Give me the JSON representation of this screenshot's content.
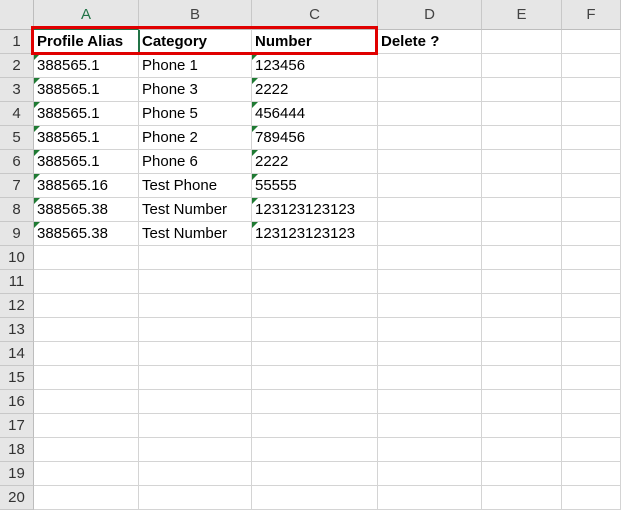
{
  "columns": [
    "A",
    "B",
    "C",
    "D",
    "E",
    "F"
  ],
  "rows": [
    {
      "n": "1",
      "a": "Profile Alias",
      "b": "Category",
      "c": "Number",
      "d": "Delete ?",
      "bold": true
    },
    {
      "n": "2",
      "a": "388565.1",
      "b": "Phone 1",
      "c": "123456"
    },
    {
      "n": "3",
      "a": "388565.1",
      "b": "Phone 3",
      "c": "2222"
    },
    {
      "n": "4",
      "a": "388565.1",
      "b": "Phone 5",
      "c": "456444"
    },
    {
      "n": "5",
      "a": "388565.1",
      "b": "Phone 2",
      "c": "789456"
    },
    {
      "n": "6",
      "a": "388565.1",
      "b": "Phone 6",
      "c": "2222"
    },
    {
      "n": "7",
      "a": "388565.16",
      "b": "Test Phone",
      "c": "55555"
    },
    {
      "n": "8",
      "a": "388565.38",
      "b": "Test Number",
      "c": "123123123123"
    },
    {
      "n": "9",
      "a": "388565.38",
      "b": "Test Number",
      "c": "123123123123"
    },
    {
      "n": "10"
    },
    {
      "n": "11"
    },
    {
      "n": "12"
    },
    {
      "n": "13"
    },
    {
      "n": "14"
    },
    {
      "n": "15"
    },
    {
      "n": "16"
    },
    {
      "n": "17"
    },
    {
      "n": "18"
    },
    {
      "n": "19"
    },
    {
      "n": "20"
    }
  ],
  "colors": {
    "highlight_border": "#e00000",
    "selected_column_header": "#217346",
    "error_flag": "#1f7a33"
  }
}
